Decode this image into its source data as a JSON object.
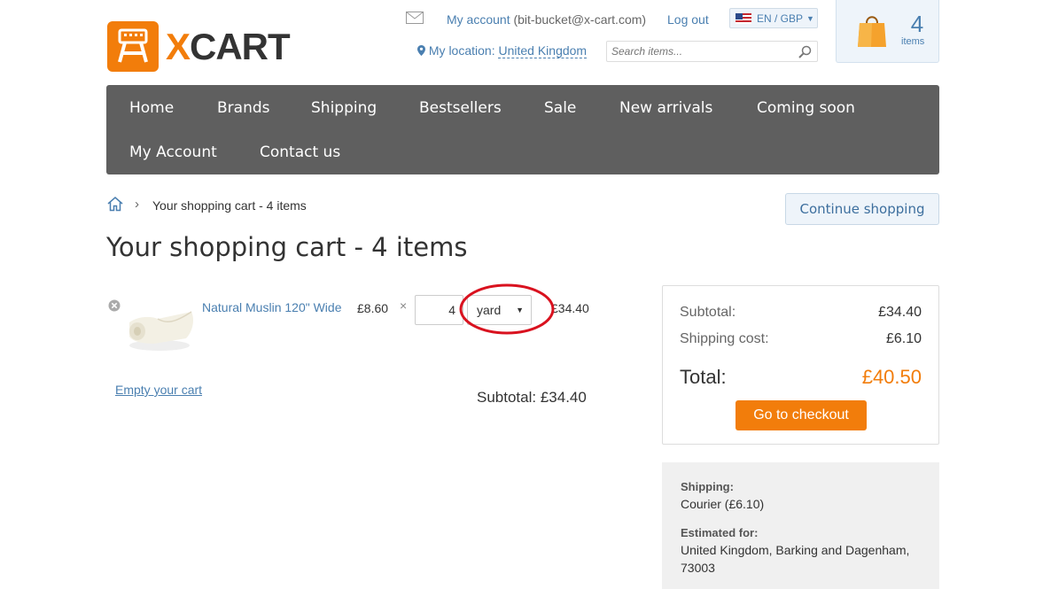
{
  "brand": {
    "logo_text_x": "X",
    "logo_text_rest": "CART"
  },
  "header": {
    "account_label": "My account",
    "account_email": "(bit-bucket@x-cart.com)",
    "logout": "Log out",
    "language": "EN / GBP",
    "location_label": "My location:",
    "location_value": "United Kingdom",
    "search_placeholder": "Search items..."
  },
  "minicart": {
    "count": "4",
    "label": "items"
  },
  "nav": {
    "items": [
      "Home",
      "Brands",
      "Shipping",
      "Bestsellers",
      "Sale",
      "New arrivals",
      "Coming soon",
      "My Account",
      "Contact us"
    ]
  },
  "breadcrumb": {
    "current": "Your shopping cart - 4 items"
  },
  "continue_shopping": "Continue shopping",
  "page_title": "Your shopping cart - 4 items",
  "cart": {
    "item": {
      "name": "Natural Muslin 120\" Wide",
      "price": "£8.60",
      "times": "×",
      "quantity": "4",
      "unit": "yard",
      "total": "£34.40"
    },
    "empty_cart": "Empty your cart",
    "subtotal": "Subtotal: £34.40"
  },
  "totals": {
    "subtotal_label": "Subtotal:",
    "subtotal_value": "£34.40",
    "shipping_label": "Shipping cost:",
    "shipping_value": "£6.10",
    "total_label": "Total:",
    "total_value": "£40.50",
    "checkout": "Go to checkout"
  },
  "shipping_info": {
    "shipping_label": "Shipping:",
    "shipping_value": "Courier (£6.10)",
    "estimated_label": "Estimated for:",
    "estimated_value": "United Kingdom, Barking and Dagenham, 73003"
  },
  "colors": {
    "accent": "#f27d0b",
    "link": "#4a7fb0",
    "nav_bg": "#5f5f5f",
    "annotation": "#d9121f"
  }
}
